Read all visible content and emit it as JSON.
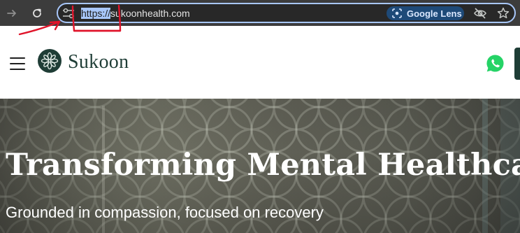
{
  "browser": {
    "url_selected": "https://",
    "url_rest": "sukoonhealth.com",
    "lens_label": "Google Lens",
    "icons": {
      "forward": "forward-arrow-icon",
      "reload": "reload-icon",
      "site_info": "site-settings-icon",
      "lens": "google-lens-icon",
      "tracking": "eye-slash-icon",
      "bookmark": "star-icon"
    }
  },
  "header": {
    "brand_name": "Sukoon",
    "icons": {
      "menu": "hamburger-menu-icon",
      "logo": "sukoon-logo-icon",
      "chat": "whatsapp-icon"
    }
  },
  "hero": {
    "title": "Transforming Mental Healthcare",
    "subtitle": "Grounded in compassion, focused on recovery"
  },
  "colors": {
    "brand": "#1f3d36",
    "whatsapp": "#25d366",
    "omnibox_border": "#a8c7fa",
    "toolbar": "#3c3c3c",
    "annotation": "#e0142a"
  }
}
